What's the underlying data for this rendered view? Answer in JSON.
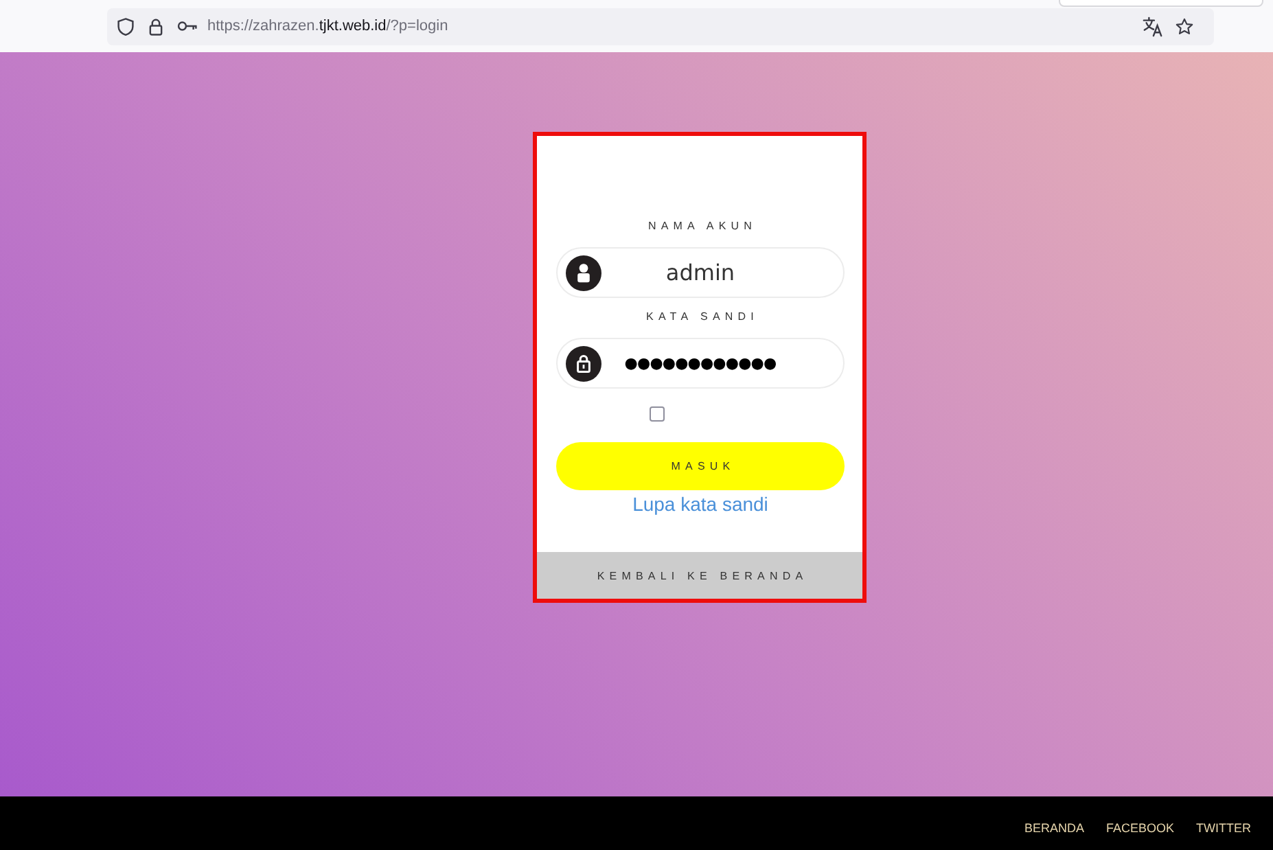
{
  "browser": {
    "url": {
      "prefix": "https://zahrazen.",
      "domain": "tjkt.web.id",
      "suffix": "/?p=login"
    }
  },
  "login": {
    "fields": [
      {
        "kind": "text",
        "label": "NAMA AKUN",
        "value": "admin"
      },
      {
        "kind": "password",
        "label": "KATA SANDI",
        "value": "●●●●●●●●●●●●"
      }
    ],
    "remember": {
      "checked": false
    },
    "submit": "MASUK",
    "forgot_link": "Lupa kata sandi",
    "back_link": "KEMBALI KE BERANDA"
  },
  "footer": {
    "links": [
      "BERANDA",
      "FACEBOOK",
      "TWITTER"
    ]
  }
}
